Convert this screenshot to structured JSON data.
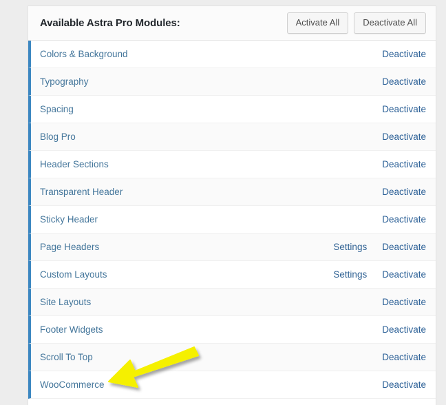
{
  "panel": {
    "title": "Available Astra Pro Modules:",
    "buttons": [
      {
        "label": "Activate All",
        "name": "activate-all-button"
      },
      {
        "label": "Deactivate All",
        "name": "deactivate-all-button"
      }
    ],
    "action_labels": {
      "settings": "Settings",
      "deactivate": "Deactivate"
    },
    "modules": [
      {
        "name": "Colors & Background",
        "settings": false,
        "deactivate": "Deactivate"
      },
      {
        "name": "Typography",
        "settings": false,
        "deactivate": "Deactivate"
      },
      {
        "name": "Spacing",
        "settings": false,
        "deactivate": "Deactivate"
      },
      {
        "name": "Blog Pro",
        "settings": false,
        "deactivate": "Deactivate"
      },
      {
        "name": "Header Sections",
        "settings": false,
        "deactivate": "Deactivate"
      },
      {
        "name": "Transparent Header",
        "settings": false,
        "deactivate": "Deactivate"
      },
      {
        "name": "Sticky Header",
        "settings": false,
        "deactivate": "Deactivate"
      },
      {
        "name": "Page Headers",
        "settings": true,
        "settings_label": "Settings",
        "deactivate": "Deactivate"
      },
      {
        "name": "Custom Layouts",
        "settings": true,
        "settings_label": "Settings",
        "deactivate": "Deactivate"
      },
      {
        "name": "Site Layouts",
        "settings": false,
        "deactivate": "Deactivate"
      },
      {
        "name": "Footer Widgets",
        "settings": false,
        "deactivate": "Deactivate"
      },
      {
        "name": "Scroll To Top",
        "settings": false,
        "deactivate": "Deactivate"
      },
      {
        "name": "WooCommerce",
        "settings": false,
        "deactivate": "Deactivate"
      }
    ]
  },
  "annotation": {
    "arrow_color": "#f5f000",
    "arrow_points_to": "WooCommerce"
  },
  "colors": {
    "page_background": "#ededed",
    "panel_background": "#ffffff",
    "row_accent": "#3c87c1",
    "link": "#44769b",
    "alt_row": "#fafafa",
    "title": "#23282d"
  }
}
